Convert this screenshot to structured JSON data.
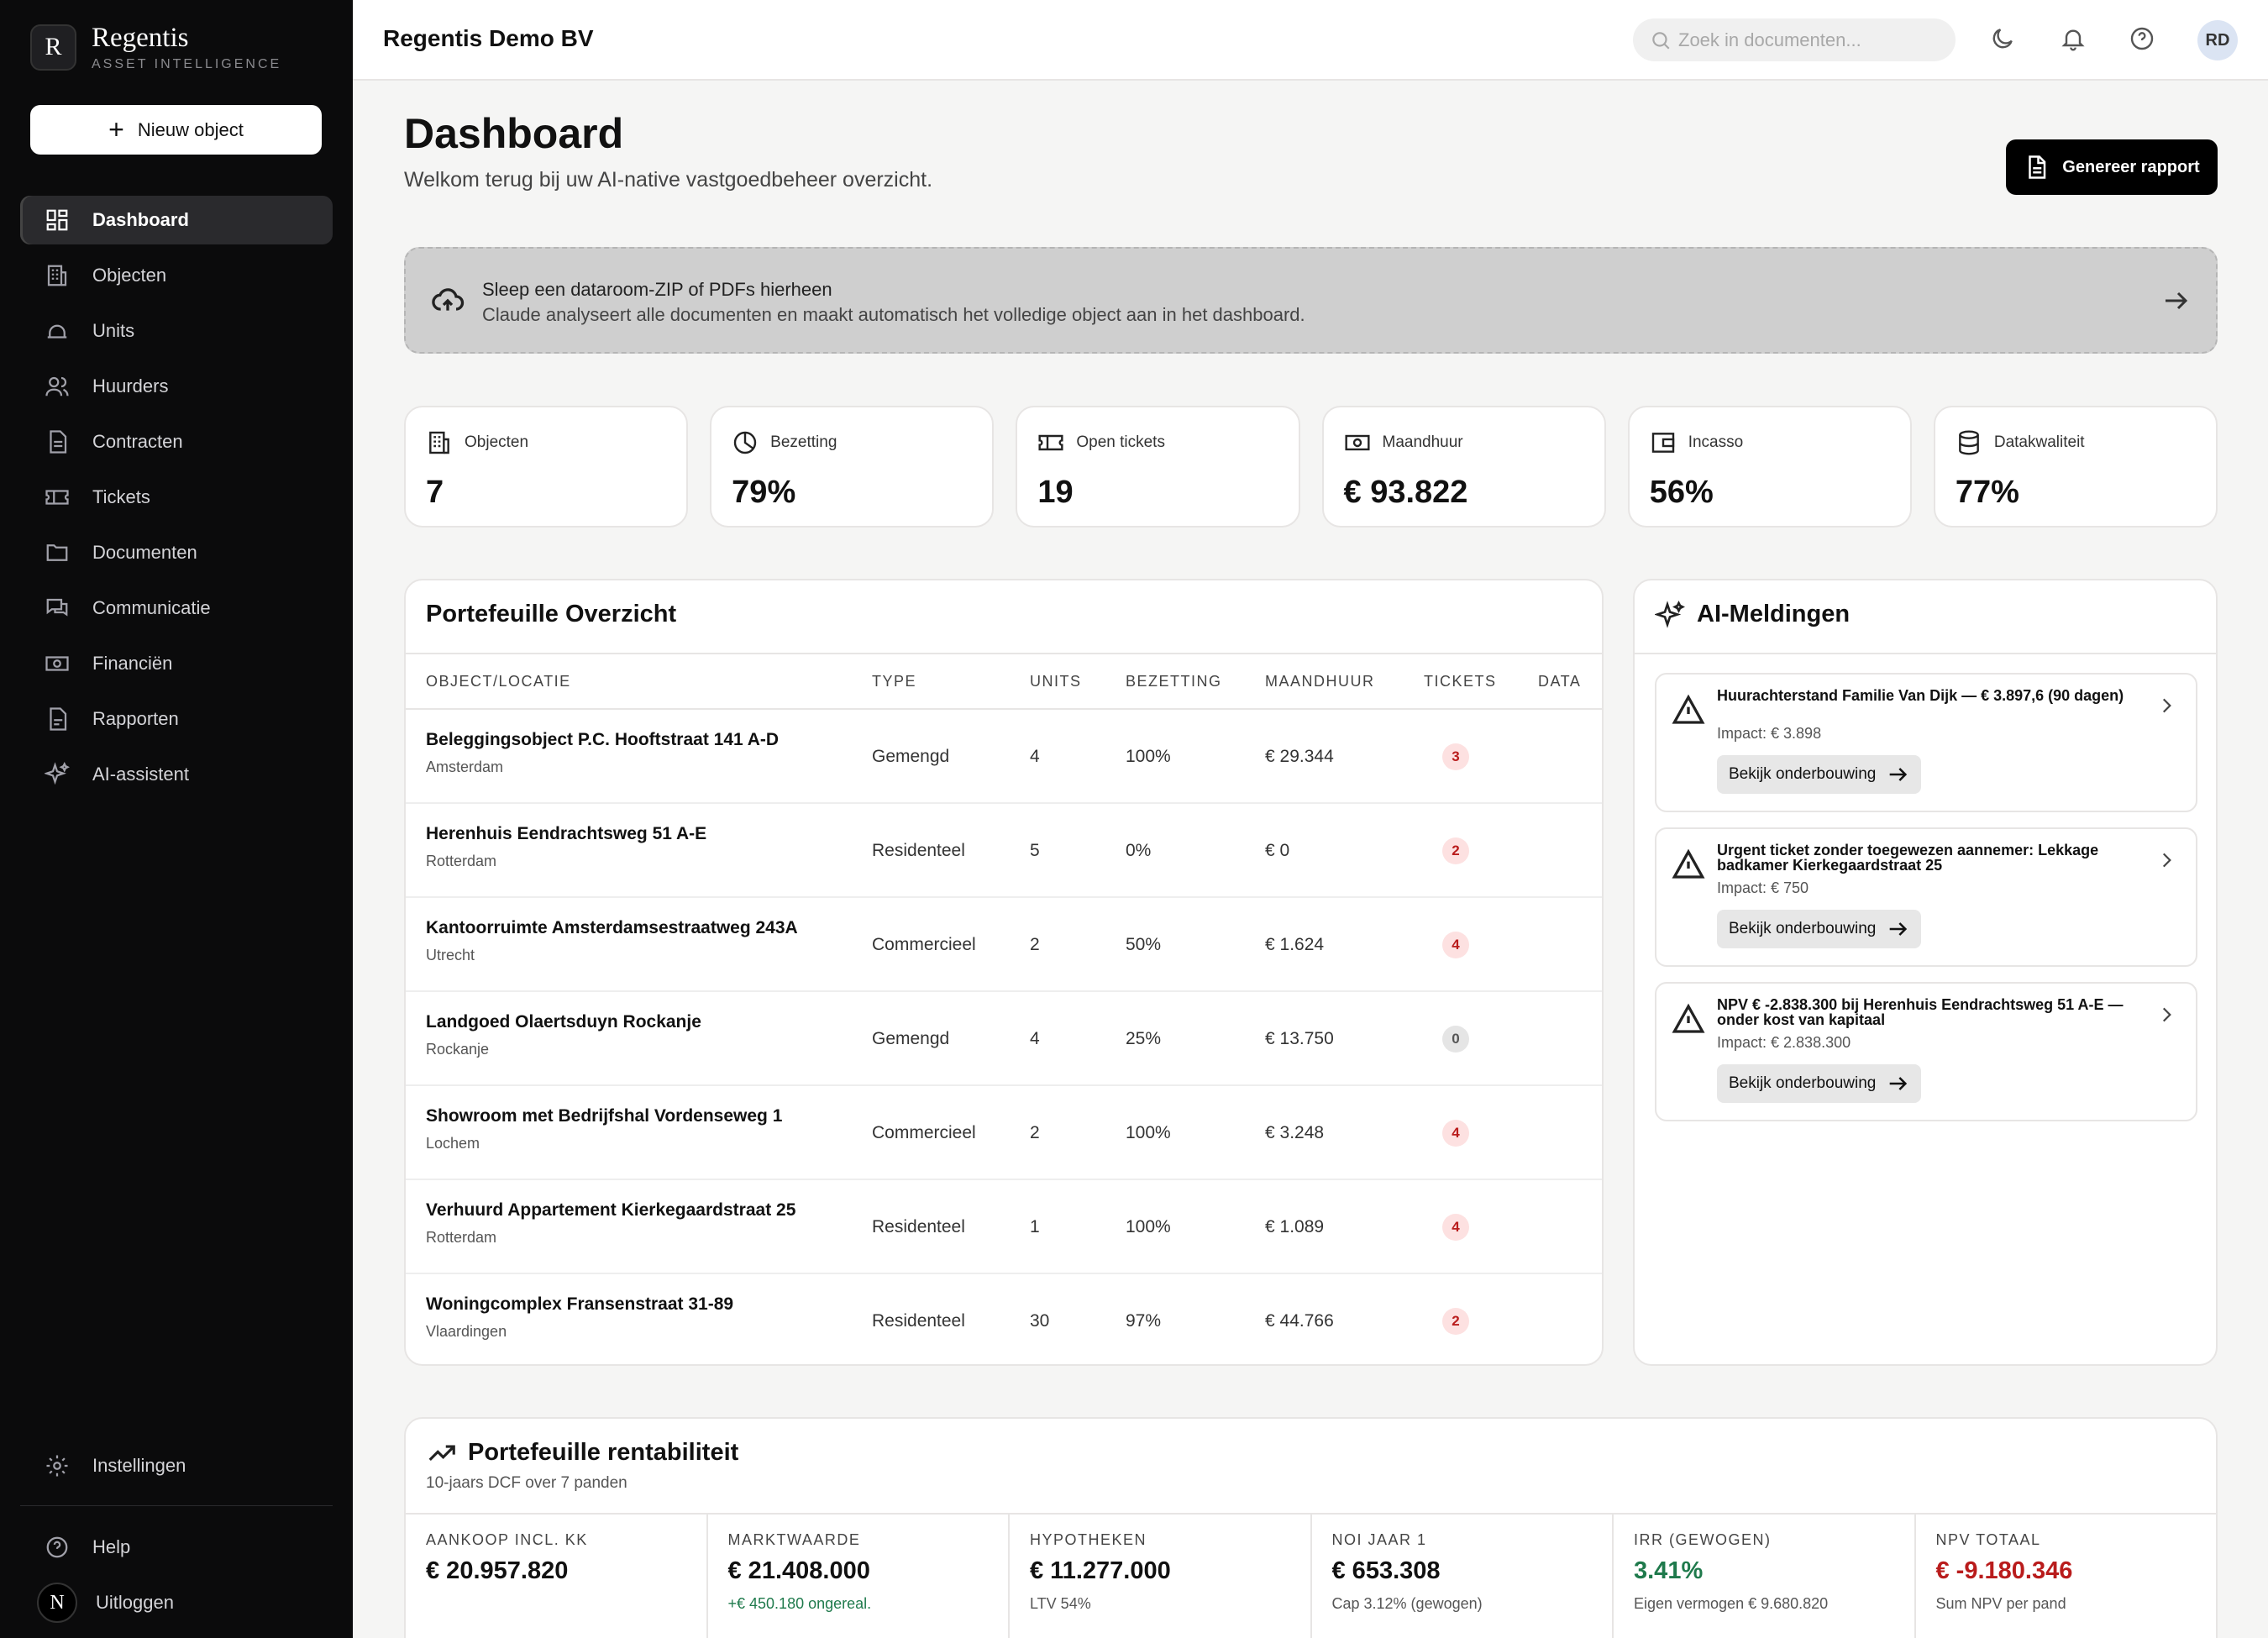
{
  "sidebar": {
    "brand_initial": "R",
    "brand_name": "Regentis",
    "brand_tagline": "ASSET INTELLIGENCE",
    "new_button": "Nieuw object",
    "items": [
      {
        "label": "Dashboard",
        "icon": "dashboard-icon"
      },
      {
        "label": "Objecten",
        "icon": "building-icon"
      },
      {
        "label": "Units",
        "icon": "unit-icon"
      },
      {
        "label": "Huurders",
        "icon": "users-icon"
      },
      {
        "label": "Contracten",
        "icon": "contract-icon"
      },
      {
        "label": "Tickets",
        "icon": "ticket-icon"
      },
      {
        "label": "Documenten",
        "icon": "folder-icon"
      },
      {
        "label": "Communicatie",
        "icon": "chat-icon"
      },
      {
        "label": "Financiën",
        "icon": "money-icon"
      },
      {
        "label": "Rapporten",
        "icon": "report-icon"
      },
      {
        "label": "AI-assistent",
        "icon": "sparkle-icon"
      }
    ],
    "settings": "Instellingen",
    "help": "Help",
    "user_initial": "N",
    "logout": "Uitloggen"
  },
  "topbar": {
    "org": "Regentis Demo BV",
    "search_placeholder": "Zoek in documenten...",
    "avatar": "RD"
  },
  "header": {
    "title": "Dashboard",
    "subtitle": "Welkom terug bij uw AI-native vastgoedbeheer overzicht.",
    "report_button": "Genereer rapport"
  },
  "dropzone": {
    "title": "Sleep een dataroom-ZIP of PDFs hierheen",
    "subtitle": "Claude analyseert alle documenten en maakt automatisch het volledige object aan in het dashboard."
  },
  "kpis": [
    {
      "label": "Objecten",
      "value": "7",
      "icon": "building-icon"
    },
    {
      "label": "Bezetting",
      "value": "79%",
      "icon": "pie-icon"
    },
    {
      "label": "Open tickets",
      "value": "19",
      "icon": "ticket-icon"
    },
    {
      "label": "Maandhuur",
      "value": "€ 93.822",
      "icon": "money-icon"
    },
    {
      "label": "Incasso",
      "value": "56%",
      "icon": "wallet-icon"
    },
    {
      "label": "Datakwaliteit",
      "value": "77%",
      "icon": "database-icon"
    }
  ],
  "portfolio": {
    "title": "Portefeuille Overzicht",
    "columns": [
      "OBJECT/LOCATIE",
      "TYPE",
      "UNITS",
      "BEZETTING",
      "MAANDHUUR",
      "TICKETS",
      "DATA"
    ],
    "rows": [
      {
        "name": "Beleggingsobject P.C. Hooftstraat 141 A-D",
        "city": "Amsterdam",
        "type": "Gemengd",
        "units": "4",
        "occupancy": "100%",
        "rent": "€ 29.344",
        "tickets": "3"
      },
      {
        "name": "Herenhuis Eendrachtsweg 51 A-E",
        "city": "Rotterdam",
        "type": "Residenteel",
        "units": "5",
        "occupancy": "0%",
        "rent": "€ 0",
        "tickets": "2"
      },
      {
        "name": "Kantoorruimte Amsterdamsestraatweg 243A",
        "city": "Utrecht",
        "type": "Commercieel",
        "units": "2",
        "occupancy": "50%",
        "rent": "€ 1.624",
        "tickets": "4"
      },
      {
        "name": "Landgoed Olaertsduyn Rockanje",
        "city": "Rockanje",
        "type": "Gemengd",
        "units": "4",
        "occupancy": "25%",
        "rent": "€ 13.750",
        "tickets": "0"
      },
      {
        "name": "Showroom met Bedrijfshal Vordenseweg 1",
        "city": "Lochem",
        "type": "Commercieel",
        "units": "2",
        "occupancy": "100%",
        "rent": "€ 3.248",
        "tickets": "4"
      },
      {
        "name": "Verhuurd Appartement Kierkegaardstraat 25",
        "city": "Rotterdam",
        "type": "Residenteel",
        "units": "1",
        "occupancy": "100%",
        "rent": "€ 1.089",
        "tickets": "4"
      },
      {
        "name": "Woningcomplex Fransenstraat 31-89",
        "city": "Vlaardingen",
        "type": "Residenteel",
        "units": "30",
        "occupancy": "97%",
        "rent": "€ 44.766",
        "tickets": "2"
      }
    ]
  },
  "ai": {
    "title": "AI-Meldingen",
    "alerts": [
      {
        "title": "Huurachterstand Familie Van Dijk — € 3.897,6 (90 dagen)",
        "impact": "Impact: € 3.898",
        "button": "Bekijk onderbouwing"
      },
      {
        "title": "Urgent ticket zonder toegewezen aannemer: Lekkage badkamer Kierkegaardstraat 25",
        "impact": "Impact: € 750",
        "button": "Bekijk onderbouwing"
      },
      {
        "title": "NPV € -2.838.300 bij Herenhuis Eendrachtsweg 51 A-E — onder kost van kapitaal",
        "impact": "Impact: € 2.838.300",
        "button": "Bekijk onderbouwing"
      }
    ]
  },
  "profit": {
    "title": "Portefeuille rentabiliteit",
    "subtitle": "10-jaars DCF over 7 panden",
    "metrics": [
      {
        "label": "AANKOOP INCL. KK",
        "value": "€ 20.957.820",
        "note": ""
      },
      {
        "label": "MARKTWAARDE",
        "value": "€ 21.408.000",
        "note": "+€ 450.180 ongereal."
      },
      {
        "label": "HYPOTHEKEN",
        "value": "€ 11.277.000",
        "note": "LTV 54%"
      },
      {
        "label": "NOI JAAR 1",
        "value": "€ 653.308",
        "note": "Cap 3.12% (gewogen)"
      },
      {
        "label": "IRR (GEWOGEN)",
        "value": "3.41%",
        "note": "Eigen vermogen € 9.680.820"
      },
      {
        "label": "NPV TOTAAL",
        "value": "€ -9.180.346",
        "note": "Sum NPV per pand"
      }
    ]
  }
}
